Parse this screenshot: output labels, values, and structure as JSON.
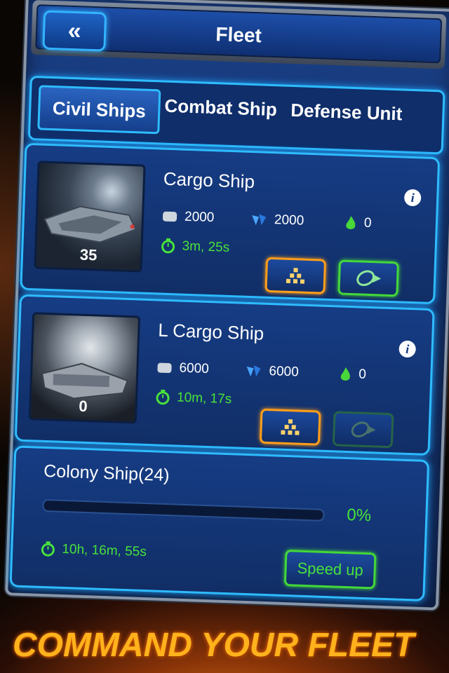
{
  "header": {
    "title": "Fleet",
    "back_label": "«"
  },
  "tabs": [
    {
      "label": "Civil Ships",
      "active": true
    },
    {
      "label": "Combat Ship",
      "active": false
    },
    {
      "label": "Defense Unit",
      "active": false
    }
  ],
  "ships": [
    {
      "name": "Cargo Ship",
      "count": "35",
      "resources": {
        "metal": "2000",
        "crystal": "2000",
        "fuel": "0"
      },
      "build_time": "3m, 25s",
      "send_enabled": true
    },
    {
      "name": "L Cargo Ship",
      "count": "0",
      "resources": {
        "metal": "6000",
        "crystal": "6000",
        "fuel": "0"
      },
      "build_time": "10m, 17s",
      "send_enabled": false
    }
  ],
  "colony": {
    "name": "Colony Ship(24)",
    "progress": 0,
    "progress_label": "0%",
    "remaining": "10h, 16m, 55s",
    "speed_label": "Speed up"
  },
  "info_label": "i",
  "tagline": "COMMAND YOUR FLEET",
  "colors": {
    "accent": "#2ebcff",
    "green": "#48e23a",
    "orange": "#ff9e1a",
    "panel": "#163c84"
  }
}
